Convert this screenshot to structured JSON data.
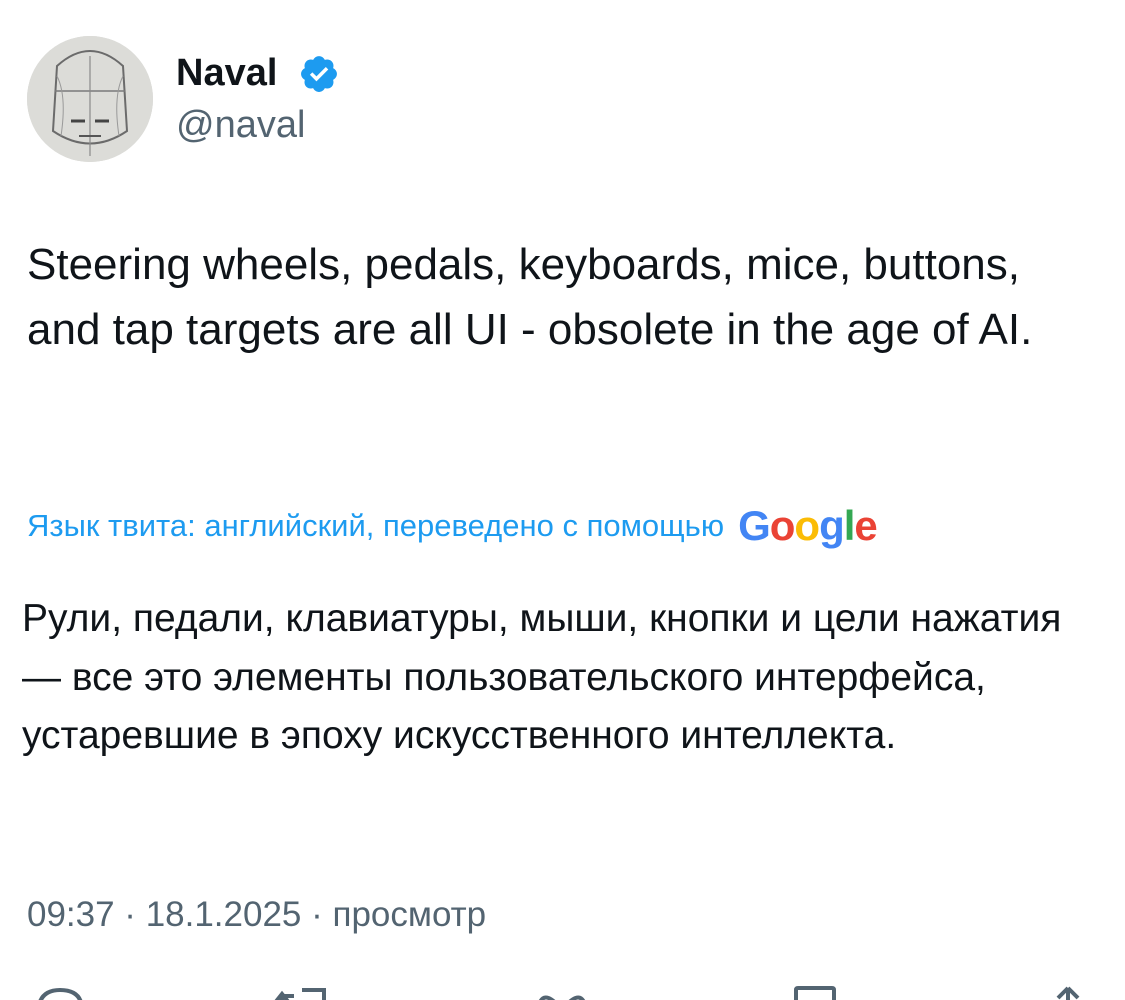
{
  "author": {
    "display_name": "Naval",
    "handle": "@naval",
    "verified": true,
    "avatar_icon": "sketch-portrait-avatar"
  },
  "tweet": {
    "text": "Steering wheels, pedals, keyboards, mice, buttons, and tap targets are all UI - obsolete in the age of AI.",
    "translation_label": "Язык твита: английский, переведено с помощью",
    "translation_provider": "Google",
    "translated_text": "Рули, педали, клавиатуры, мыши, кнопки и цели нажатия — все это элементы пользовательского интерфейса, устаревшие в эпоху искусственного интеллекта.",
    "meta": "09:37 · 18.1.2025 · просмотр"
  },
  "actions": {
    "icons": [
      "reply-icon",
      "retweet-icon",
      "like-icon",
      "bookmark-icon",
      "share-icon"
    ]
  },
  "colors": {
    "text": "#0f1419",
    "secondary": "#536471",
    "link": "#1d9bf0",
    "verified": "#1d9bf0",
    "google_blue": "#4285f4",
    "google_red": "#ea4335",
    "google_yellow": "#fbbc05",
    "google_green": "#34a853"
  }
}
